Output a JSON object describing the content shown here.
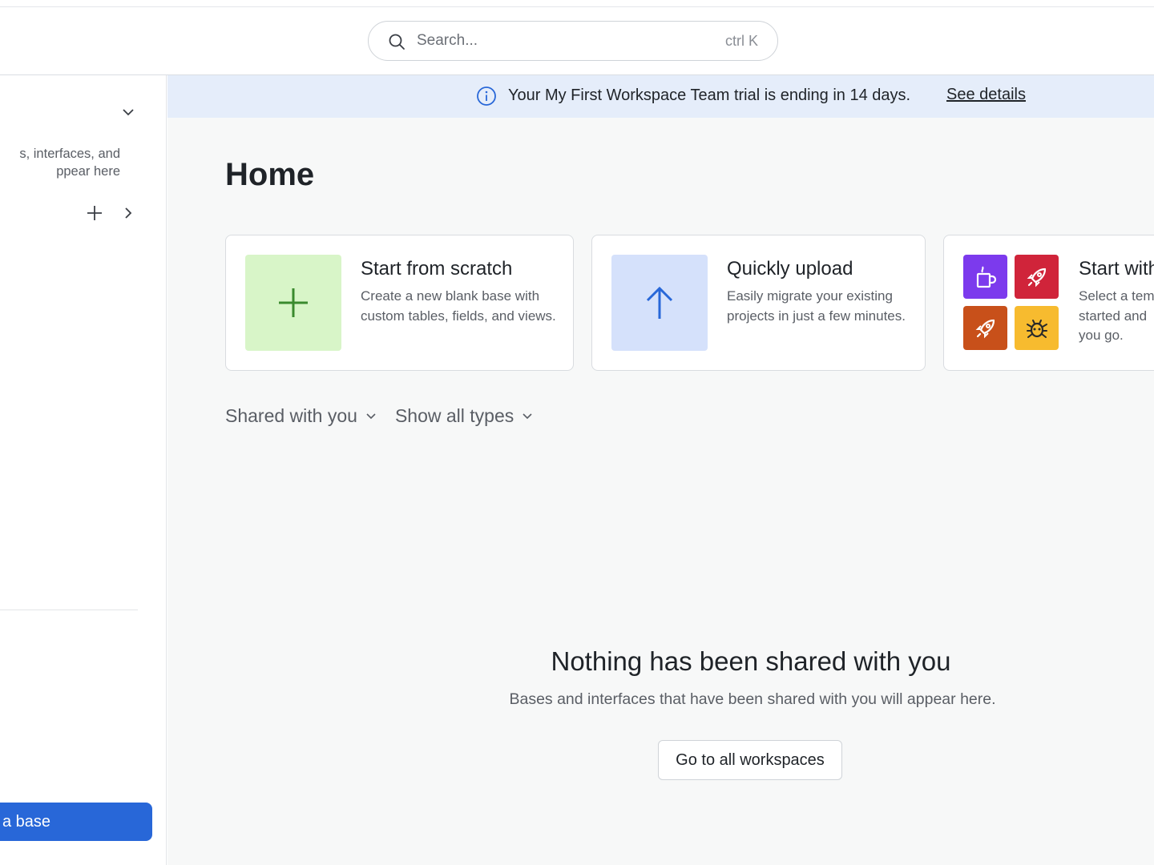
{
  "header": {
    "search_placeholder": "Search...",
    "search_shortcut": "ctrl K"
  },
  "sidebar": {
    "empty_text_line1": "s, interfaces, and",
    "empty_text_line2": "ppear here",
    "create_button": "a base"
  },
  "banner": {
    "message": "Your My First Workspace Team trial is ending in 14 days.",
    "link": "See details"
  },
  "main": {
    "title": "Home",
    "cards": [
      {
        "title": "Start from scratch",
        "description": "Create a new blank base with custom tables, fields, and views.",
        "tile_color": "#d8f5c8"
      },
      {
        "title": "Quickly upload",
        "description": "Easily migrate your existing projects in just a few minutes.",
        "tile_color": "#d5e1fb"
      },
      {
        "title": "Start with",
        "description_line1": "Select a tem",
        "description_line2": "started and",
        "description_line3": "you go."
      }
    ],
    "filters": {
      "shared": "Shared with you",
      "types": "Show all types"
    },
    "empty_state": {
      "title": "Nothing has been shared with you",
      "subtitle": "Bases and interfaces that have been shared with you will appear here.",
      "button": "Go to all workspaces"
    }
  },
  "colors": {
    "accent": "#2867d8",
    "banner_bg": "#e5edfa",
    "template_purple": "#7c3aed",
    "template_red": "#d0243a",
    "template_orange": "#c8501a",
    "template_yellow": "#f7bb2f"
  }
}
